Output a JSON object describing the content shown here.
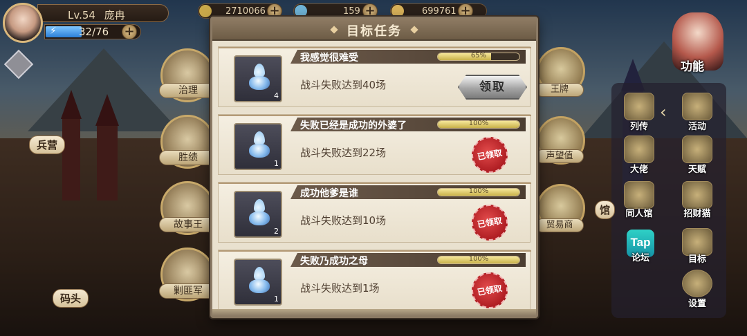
{
  "hud": {
    "level": "Lv.54",
    "player_name": "庞冉",
    "energy": "32/76",
    "resources": [
      {
        "name": "gold",
        "value": "2710066",
        "color": "#c9a94a"
      },
      {
        "name": "gem",
        "value": "159",
        "color": "#6fb3d6"
      },
      {
        "name": "coin",
        "value": "699761",
        "color": "#d9b25a"
      }
    ]
  },
  "map_labels": {
    "barracks": "兵营",
    "dock": "码头",
    "hall": "馆"
  },
  "left_menu": [
    {
      "label": "治理",
      "icon": "crown-icon"
    },
    {
      "label": "胜绩",
      "icon": "winner-icon"
    },
    {
      "label": "故事王",
      "icon": "story-icon"
    },
    {
      "label": "剿匪军",
      "icon": "swords-icon"
    }
  ],
  "mid_right_menu": [
    {
      "label": "王牌",
      "icon": "mvp-icon"
    },
    {
      "label": "声望值",
      "icon": "reputation-icon"
    },
    {
      "label": "贸易商",
      "icon": "trade-icon"
    }
  ],
  "function_label": "功能",
  "right_menu": [
    {
      "label": "列传",
      "icon": "book-icon"
    },
    {
      "label": "活动",
      "icon": "star-badge-icon"
    },
    {
      "label": "大佬",
      "icon": "boss-icon"
    },
    {
      "label": "天赋",
      "icon": "talent-icon"
    },
    {
      "label": "同人馆",
      "icon": "gallery-icon"
    },
    {
      "label": "招财猫",
      "icon": "lucky-cat-icon"
    },
    {
      "label": "论坛",
      "icon": "tap-icon",
      "glyph": "Tap"
    },
    {
      "label": "目标",
      "icon": "target-board-icon"
    },
    {
      "label": "设置",
      "icon": "gear-icon"
    }
  ],
  "modal": {
    "title": "目标任务",
    "tasks": [
      {
        "name": "我感觉很难受",
        "progress": 0.65,
        "progress_label": "65%",
        "desc": "战斗失败达到40场",
        "count": "4",
        "state": "claimable",
        "action_label": "领取"
      },
      {
        "name": "失败已经是成功的外婆了",
        "progress": 1.0,
        "progress_label": "100%",
        "desc": "战斗失败达到22场",
        "count": "1",
        "state": "claimed",
        "action_label": "已领取"
      },
      {
        "name": "成功他爹是谁",
        "progress": 1.0,
        "progress_label": "100%",
        "desc": "战斗失败达到10场",
        "count": "2",
        "state": "claimed",
        "action_label": "已领取"
      },
      {
        "name": "失败乃成功之母",
        "progress": 1.0,
        "progress_label": "100%",
        "desc": "战斗失败达到1场",
        "count": "1",
        "state": "claimed",
        "action_label": "已领取"
      }
    ]
  }
}
